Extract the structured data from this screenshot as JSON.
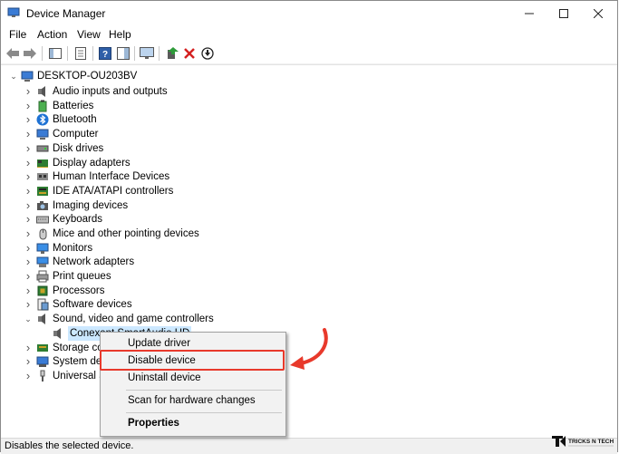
{
  "window": {
    "title": "Device Manager"
  },
  "menu": [
    "File",
    "Action",
    "View",
    "Help"
  ],
  "tree": {
    "root": "DESKTOP-OU203BV",
    "categories": [
      {
        "label": "Audio inputs and outputs",
        "icon": "speaker-icon"
      },
      {
        "label": "Batteries",
        "icon": "battery-icon"
      },
      {
        "label": "Bluetooth",
        "icon": "bluetooth-icon"
      },
      {
        "label": "Computer",
        "icon": "computer-icon"
      },
      {
        "label": "Disk drives",
        "icon": "disk-drive-icon"
      },
      {
        "label": "Display adapters",
        "icon": "display-adapter-icon"
      },
      {
        "label": "Human Interface Devices",
        "icon": "hid-icon"
      },
      {
        "label": "IDE ATA/ATAPI controllers",
        "icon": "ide-controller-icon"
      },
      {
        "label": "Imaging devices",
        "icon": "camera-icon"
      },
      {
        "label": "Keyboards",
        "icon": "keyboard-icon"
      },
      {
        "label": "Mice and other pointing devices",
        "icon": "mouse-icon"
      },
      {
        "label": "Monitors",
        "icon": "monitor-icon"
      },
      {
        "label": "Network adapters",
        "icon": "network-adapter-icon"
      },
      {
        "label": "Print queues",
        "icon": "printer-icon"
      },
      {
        "label": "Processors",
        "icon": "processor-icon"
      },
      {
        "label": "Software devices",
        "icon": "software-device-icon"
      },
      {
        "label": "Sound, video and game controllers",
        "icon": "speaker-icon"
      },
      {
        "label": "Conexant SmartAudio HD",
        "icon": "speaker-icon"
      },
      {
        "label": "Storage cor",
        "icon": "storage-icon"
      },
      {
        "label": "System dev",
        "icon": "system-device-icon"
      },
      {
        "label": "Universal Se",
        "icon": "usb-icon"
      }
    ]
  },
  "context_menu": {
    "update": "Update driver",
    "disable": "Disable device",
    "uninstall": "Uninstall device",
    "scan": "Scan for hardware changes",
    "properties": "Properties"
  },
  "status": "Disables the selected device.",
  "watermark": "TRICKS N TECH",
  "colors": {
    "highlight": "#e8392b",
    "selection": "#cce8ff",
    "arrow": "#e8392b"
  }
}
